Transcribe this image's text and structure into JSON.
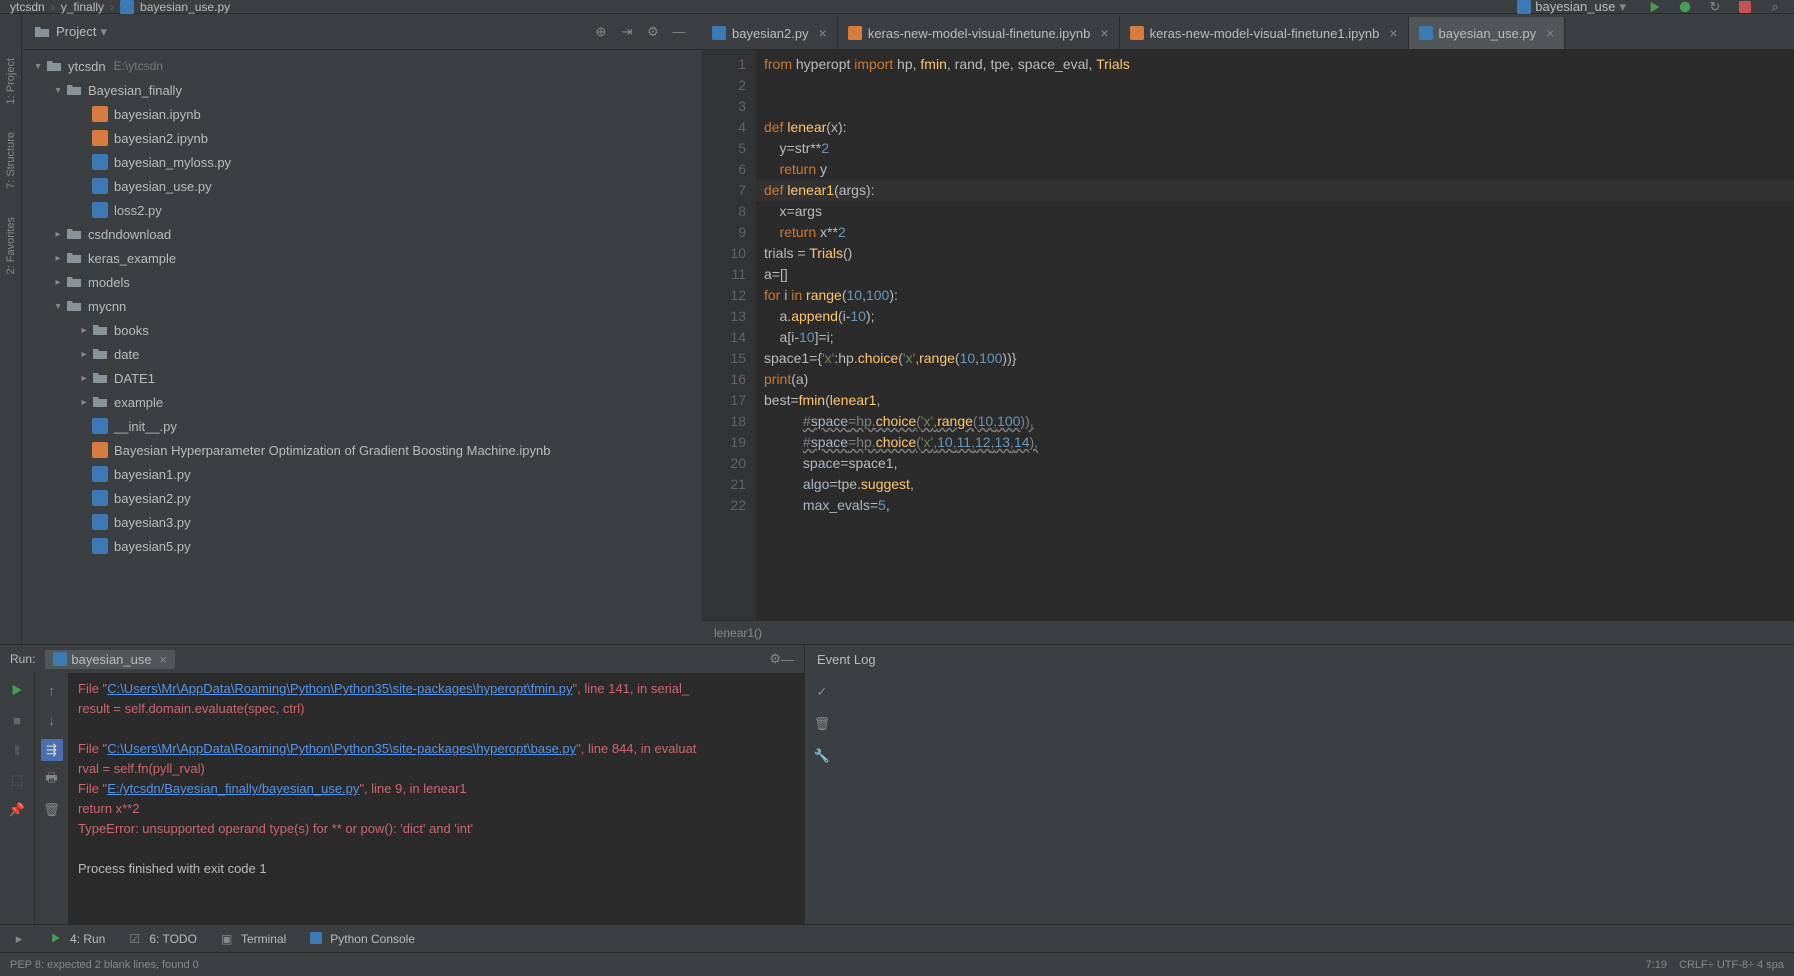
{
  "breadcrumb": {
    "proj": "ytcsdn",
    "folder": "y_finally",
    "file": "bayesian_use.py"
  },
  "run_config": {
    "label": "bayesian_use"
  },
  "project": {
    "title": "Project",
    "root": "ytcsdn",
    "root_path": "E:\\ytcsdn",
    "items": [
      {
        "name": "Bayesian_finally",
        "type": "folder",
        "expanded": true,
        "indent": 1
      },
      {
        "name": "bayesian.ipynb",
        "type": "jupyter",
        "indent": 2
      },
      {
        "name": "bayesian2.ipynb",
        "type": "jupyter",
        "indent": 2
      },
      {
        "name": "bayesian_myloss.py",
        "type": "py",
        "indent": 2
      },
      {
        "name": "bayesian_use.py",
        "type": "py",
        "indent": 2
      },
      {
        "name": "loss2.py",
        "type": "py",
        "indent": 2
      },
      {
        "name": "csdndownload",
        "type": "folder",
        "expanded": false,
        "indent": 1
      },
      {
        "name": "keras_example",
        "type": "folder",
        "expanded": false,
        "indent": 1
      },
      {
        "name": "models",
        "type": "folder",
        "expanded": false,
        "indent": 1
      },
      {
        "name": "mycnn",
        "type": "folder",
        "expanded": true,
        "indent": 1
      },
      {
        "name": "books",
        "type": "folder",
        "expanded": false,
        "indent": 2
      },
      {
        "name": "date",
        "type": "folder",
        "expanded": false,
        "indent": 2
      },
      {
        "name": "DATE1",
        "type": "folder",
        "expanded": false,
        "indent": 2
      },
      {
        "name": "example",
        "type": "folder",
        "expanded": false,
        "indent": 2
      },
      {
        "name": "__init__.py",
        "type": "py",
        "indent": 2
      },
      {
        "name": "Bayesian Hyperparameter Optimization of Gradient Boosting Machine.ipynb",
        "type": "jupyter",
        "indent": 2
      },
      {
        "name": "bayesian1.py",
        "type": "py",
        "indent": 2
      },
      {
        "name": "bayesian2.py",
        "type": "py",
        "indent": 2
      },
      {
        "name": "bayesian3.py",
        "type": "py",
        "indent": 2
      },
      {
        "name": "bayesian5.py",
        "type": "py",
        "indent": 2
      }
    ]
  },
  "tabs": [
    {
      "label": "bayesian2.py",
      "active": false
    },
    {
      "label": "keras-new-model-visual-finetune.ipynb",
      "active": false
    },
    {
      "label": "keras-new-model-visual-finetune1.ipynb",
      "active": false
    },
    {
      "label": "bayesian_use.py",
      "active": true
    }
  ],
  "code": {
    "lines": [
      "from hyperopt import hp, fmin, rand, tpe, space_eval, Trials",
      "",
      "",
      "def lenear(x):",
      "    y=str**2",
      "    return y",
      "def lenear1(args):",
      "    x=args",
      "    return x**2",
      "trials = Trials()",
      "a=[]",
      "for i in range(10,100):",
      "    a.append(i-10);",
      "    a[i-10]=i;",
      "space1={'x':hp.choice('x',range(10,100))}",
      "print(a)",
      "best=fmin(lenear1,",
      "          #space=hp.choice('x',range(10,100)),",
      "          #space=hp.choice('x',10,11,12,13,14),",
      "          space=space1,",
      "          algo=tpe.suggest,",
      "          max_evals=5,"
    ],
    "context": "lenear1()"
  },
  "run": {
    "title": "Run:",
    "tab": "bayesian_use",
    "output": [
      {
        "type": "err",
        "text": "  File \"",
        "link": "C:\\Users\\Mr\\AppData\\Roaming\\Python\\Python35\\site-packages\\hyperopt\\fmin.py",
        "suffix": "\", line 141, in serial_"
      },
      {
        "type": "err",
        "text": "    result = self.domain.evaluate(spec, ctrl)"
      },
      {
        "type": "blank",
        "text": ""
      },
      {
        "type": "err",
        "text": "  File \"",
        "link": "C:\\Users\\Mr\\AppData\\Roaming\\Python\\Python35\\site-packages\\hyperopt\\base.py",
        "suffix": "\", line 844, in evaluat"
      },
      {
        "type": "err",
        "text": "    rval = self.fn(pyll_rval)"
      },
      {
        "type": "err",
        "text": "  File \"",
        "link": "E:/ytcsdn/Bayesian_finally/bayesian_use.py",
        "suffix": "\", line 9, in lenear1"
      },
      {
        "type": "err",
        "text": "    return x**2"
      },
      {
        "type": "err",
        "text": "TypeError: unsupported operand type(s) for ** or pow(): 'dict' and 'int'"
      },
      {
        "type": "blank",
        "text": ""
      },
      {
        "type": "normal",
        "text": "Process finished with exit code 1"
      }
    ]
  },
  "event_log": {
    "title": "Event Log"
  },
  "bottom_tabs": [
    {
      "label": "4: Run"
    },
    {
      "label": "6: TODO"
    },
    {
      "label": "Terminal"
    },
    {
      "label": "Python Console"
    }
  ],
  "status": {
    "hint": "PEP 8: expected 2 blank lines, found 0",
    "pos": "7:19",
    "enc": "CRLF÷  UTF-8÷  4 spa"
  }
}
